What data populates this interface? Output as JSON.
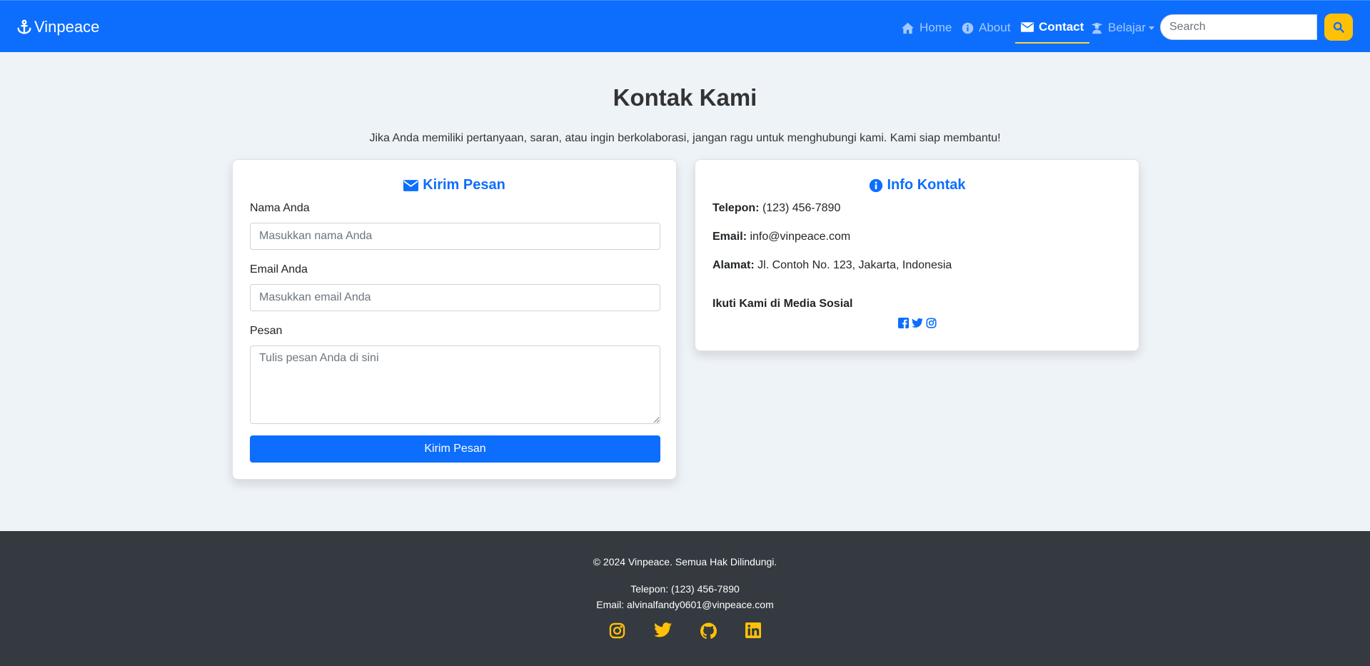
{
  "navbar": {
    "brand": "Vinpeace",
    "items": [
      {
        "label": "Home",
        "icon": "home-icon"
      },
      {
        "label": "About",
        "icon": "info-circle-icon"
      },
      {
        "label": "Contact",
        "icon": "envelope-icon",
        "active": true
      },
      {
        "label": "Belajar",
        "icon": "user-graduate-icon",
        "dropdown": true
      }
    ],
    "search_placeholder": "Search",
    "accent_color": "#0d6efd",
    "search_button_color": "#ffc107"
  },
  "main": {
    "title": "Kontak Kami",
    "intro": "Jika Anda memiliki pertanyaan, saran, atau ingin berkolaborasi, jangan ragu untuk menghubungi kami. Kami siap membantu!"
  },
  "form_card": {
    "title": "Kirim Pesan",
    "name_label": "Nama Anda",
    "name_placeholder": "Masukkan nama Anda",
    "email_label": "Email Anda",
    "email_placeholder": "Masukkan email Anda",
    "message_label": "Pesan",
    "message_placeholder": "Tulis pesan Anda di sini",
    "submit_label": "Kirim Pesan"
  },
  "info_card": {
    "title": "Info Kontak",
    "phone_label": "Telepon:",
    "phone_value": "(123) 456-7890",
    "email_label": "Email:",
    "email_value": "info@vinpeace.com",
    "address_label": "Alamat:",
    "address_value": "Jl. Contoh No. 123, Jakarta, Indonesia",
    "social_title": "Ikuti Kami di Media Sosial",
    "social_icons": [
      "facebook-icon",
      "twitter-icon",
      "instagram-icon"
    ]
  },
  "footer": {
    "copyright": "© 2024 Vinpeace. Semua Hak Dilindungi.",
    "phone": "Telepon: (123) 456-7890",
    "email": "Email: alvinalfandy0601@vinpeace.com",
    "social_icons": [
      "instagram-icon",
      "twitter-icon",
      "github-icon",
      "linkedin-icon"
    ],
    "icon_color": "#ffc107",
    "background": "#343a40"
  }
}
